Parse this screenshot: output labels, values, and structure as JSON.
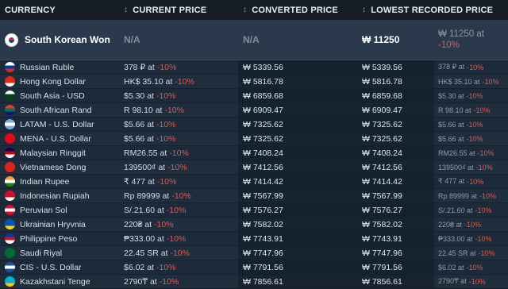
{
  "headers": {
    "currency": "CURRENCY",
    "current_price": "CURRENT PRICE",
    "converted_price": "CONVERTED PRICE",
    "lowest_price": "LOWEST RECORDED PRICE"
  },
  "base_row": {
    "currency": "South Korean Won",
    "current": "N/A",
    "converted": "N/A",
    "lowest": "₩ 11250",
    "lowest_at_line1": "₩ 11250 at",
    "lowest_at_pct": "-10%"
  },
  "rows": [
    {
      "currency": "Russian Ruble",
      "current": "378 ₽ at",
      "current_pct": "-10%",
      "converted": "₩ 5339.56",
      "lowest": "₩ 5339.56",
      "lowest_at": "378 ₽ at",
      "lowest_pct": "-10%",
      "flag_colors": [
        "#ffffff",
        "#0039a6",
        "#d52b1e"
      ]
    },
    {
      "currency": "Hong Kong Dollar",
      "current": "HK$ 35.10 at",
      "current_pct": "-10%",
      "converted": "₩ 5816.78",
      "lowest": "₩ 5816.78",
      "lowest_at": "HK$ 35.10 at",
      "lowest_pct": "-10%",
      "flag_colors": [
        "#de2910",
        "#de2910",
        "#ffffff"
      ]
    },
    {
      "currency": "South Asia - USD",
      "current": "$5.30 at",
      "current_pct": "-10%",
      "converted": "₩ 6859.68",
      "lowest": "₩ 6859.68",
      "lowest_at": "$5.30 at",
      "lowest_pct": "-10%",
      "flag_colors": [
        "#ffffff",
        "#01411c",
        "#01411c"
      ]
    },
    {
      "currency": "South African Rand",
      "current": "R 98.10 at",
      "current_pct": "-10%",
      "converted": "₩ 6909.47",
      "lowest": "₩ 6909.47",
      "lowest_at": "R 98.10 at",
      "lowest_pct": "-10%",
      "flag_colors": [
        "#e03c31",
        "#007749",
        "#001489"
      ]
    },
    {
      "currency": "LATAM - U.S. Dollar",
      "current": "$5.66 at",
      "current_pct": "-10%",
      "converted": "₩ 7325.62",
      "lowest": "₩ 7325.62",
      "lowest_at": "$5.66 at",
      "lowest_pct": "-10%",
      "flag_colors": [
        "#74acdf",
        "#ffffff",
        "#74acdf"
      ]
    },
    {
      "currency": "MENA - U.S. Dollar",
      "current": "$5.66 at",
      "current_pct": "-10%",
      "converted": "₩ 7325.62",
      "lowest": "₩ 7325.62",
      "lowest_at": "$5.66 at",
      "lowest_pct": "-10%",
      "flag_colors": [
        "#e30a17",
        "#e30a17",
        "#e30a17"
      ]
    },
    {
      "currency": "Malaysian Ringgit",
      "current": "RM26.55 at",
      "current_pct": "-10%",
      "converted": "₩ 7408.24",
      "lowest": "₩ 7408.24",
      "lowest_at": "RM26.55 at",
      "lowest_pct": "-10%",
      "flag_colors": [
        "#010066",
        "#cc0001",
        "#ffffff"
      ]
    },
    {
      "currency": "Vietnamese Dong",
      "current": "139500₫ at",
      "current_pct": "-10%",
      "converted": "₩ 7412.56",
      "lowest": "₩ 7412.56",
      "lowest_at": "139500₫ at",
      "lowest_pct": "-10%",
      "flag_colors": [
        "#da251d",
        "#da251d",
        "#da251d"
      ]
    },
    {
      "currency": "Indian Rupee",
      "current": "₹ 477 at",
      "current_pct": "-10%",
      "converted": "₩ 7414.42",
      "lowest": "₩ 7414.42",
      "lowest_at": "₹ 477 at",
      "lowest_pct": "-10%",
      "flag_colors": [
        "#ff9933",
        "#ffffff",
        "#138808"
      ]
    },
    {
      "currency": "Indonesian Rupiah",
      "current": "Rp 89999 at",
      "current_pct": "-10%",
      "converted": "₩ 7567.99",
      "lowest": "₩ 7567.99",
      "lowest_at": "Rp 89999 at",
      "lowest_pct": "-10%",
      "flag_colors": [
        "#ce1126",
        "#ce1126",
        "#ffffff"
      ]
    },
    {
      "currency": "Peruvian Sol",
      "current": "S/.21.60 at",
      "current_pct": "-10%",
      "converted": "₩ 7576.27",
      "lowest": "₩ 7576.27",
      "lowest_at": "S/.21.60 at",
      "lowest_pct": "-10%",
      "flag_colors": [
        "#d91023",
        "#ffffff",
        "#d91023"
      ]
    },
    {
      "currency": "Ukrainian Hryvnia",
      "current": "220₴ at",
      "current_pct": "-10%",
      "converted": "₩ 7582.02",
      "lowest": "₩ 7582.02",
      "lowest_at": "220₴ at",
      "lowest_pct": "-10%",
      "flag_colors": [
        "#0057b7",
        "#0057b7",
        "#ffd700"
      ]
    },
    {
      "currency": "Philippine Peso",
      "current": "₱333.00 at",
      "current_pct": "-10%",
      "converted": "₩ 7743.91",
      "lowest": "₩ 7743.91",
      "lowest_at": "₱333.00 at",
      "lowest_pct": "-10%",
      "flag_colors": [
        "#0038a8",
        "#ce1126",
        "#ffffff"
      ]
    },
    {
      "currency": "Saudi Riyal",
      "current": "22.45 SR at",
      "current_pct": "-10%",
      "converted": "₩ 7747.96",
      "lowest": "₩ 7747.96",
      "lowest_at": "22.45 SR at",
      "lowest_pct": "-10%",
      "flag_colors": [
        "#006c35",
        "#006c35",
        "#006c35"
      ]
    },
    {
      "currency": "CIS - U.S. Dollar",
      "current": "$6.02 at",
      "current_pct": "-10%",
      "converted": "₩ 7791.56",
      "lowest": "₩ 7791.56",
      "lowest_at": "$6.02 at",
      "lowest_pct": "-10%",
      "flag_colors": [
        "#1f4fa0",
        "#ffffff",
        "#1f4fa0"
      ]
    },
    {
      "currency": "Kazakhstani Tenge",
      "current": "2790₸ at",
      "current_pct": "-10%",
      "converted": "₩ 7856.61",
      "lowest": "₩ 7856.61",
      "lowest_at": "2790₸ at",
      "lowest_pct": "-10%",
      "flag_colors": [
        "#00afca",
        "#00afca",
        "#fec50c"
      ]
    }
  ]
}
